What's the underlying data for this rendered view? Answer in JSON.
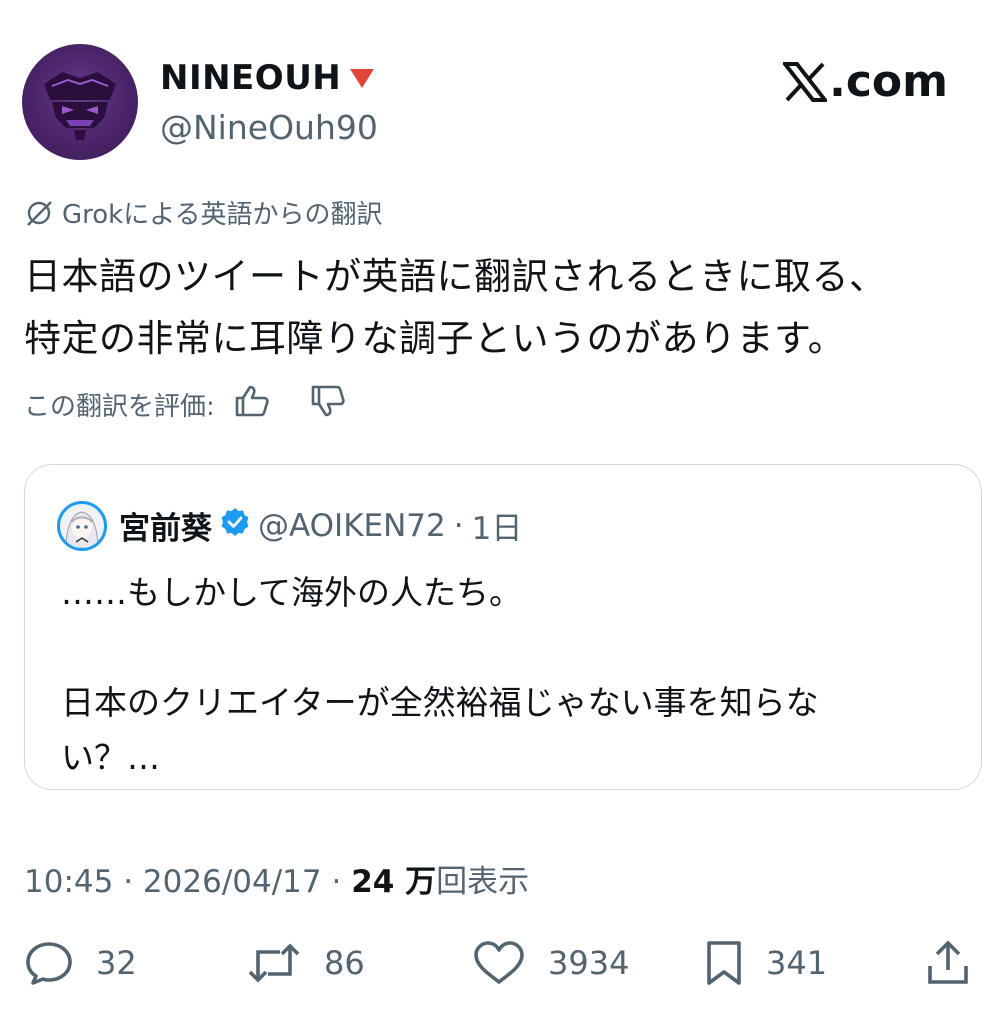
{
  "author": {
    "display_name": "NINEOUH",
    "handle": "@NineOuh90",
    "flag_emoji": "🔻"
  },
  "brand": {
    "logo_text": ".com"
  },
  "translation": {
    "notice": "Grokによる英語からの翻訳",
    "text_lines": [
      "日本語のツイートが英語に翻訳されるときに取る、",
      "特定の非常に耳障りな調子というのがあります。"
    ],
    "rate_label": "この翻訳を評価:"
  },
  "quoted": {
    "name": "宮前葵",
    "handle": "@AOIKEN72",
    "separator": "·",
    "time": "1日",
    "body_lines": [
      "……もしかして海外の人たち。",
      "",
      "日本のクリエイターが全然裕福じゃない事を知らな",
      "い？…"
    ]
  },
  "meta": {
    "time": "10:45",
    "dot": "·",
    "date": "2026/04/17",
    "views_count": "24 万",
    "views_label": "回表示"
  },
  "actions": {
    "replies": "32",
    "reposts": "86",
    "likes": "3934",
    "bookmarks": "341"
  },
  "colors": {
    "text": "#0f1419",
    "secondary": "#536471",
    "border": "#cfd9de",
    "verified": "#1d9bf0",
    "avatar_purple": "#4a2468"
  }
}
